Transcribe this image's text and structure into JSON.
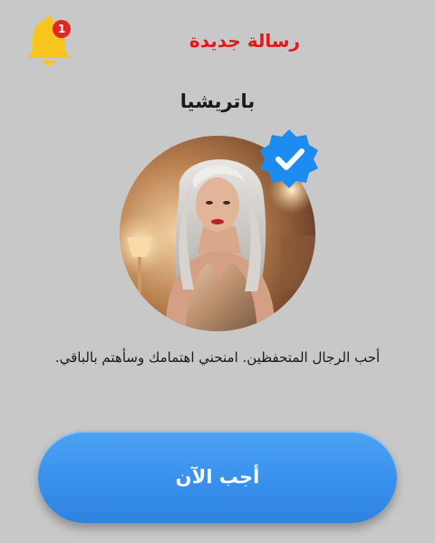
{
  "notification": {
    "icon": "bell-icon",
    "count": "1",
    "bell_color": "#f7c51c",
    "badge_color": "#e5251f"
  },
  "header": {
    "title": "رسالة جديدة",
    "title_color": "#e01a1a"
  },
  "profile": {
    "name": "باتريشيا",
    "verified_icon": "verified-check-icon",
    "verified_color": "#1d8cf0",
    "bio": "أحب الرجال المتحفظين. امنحني اهتمامك وسأهتم بالباقي."
  },
  "actions": {
    "reply_label": "أجب الآن",
    "reply_color": "#3890ec"
  }
}
